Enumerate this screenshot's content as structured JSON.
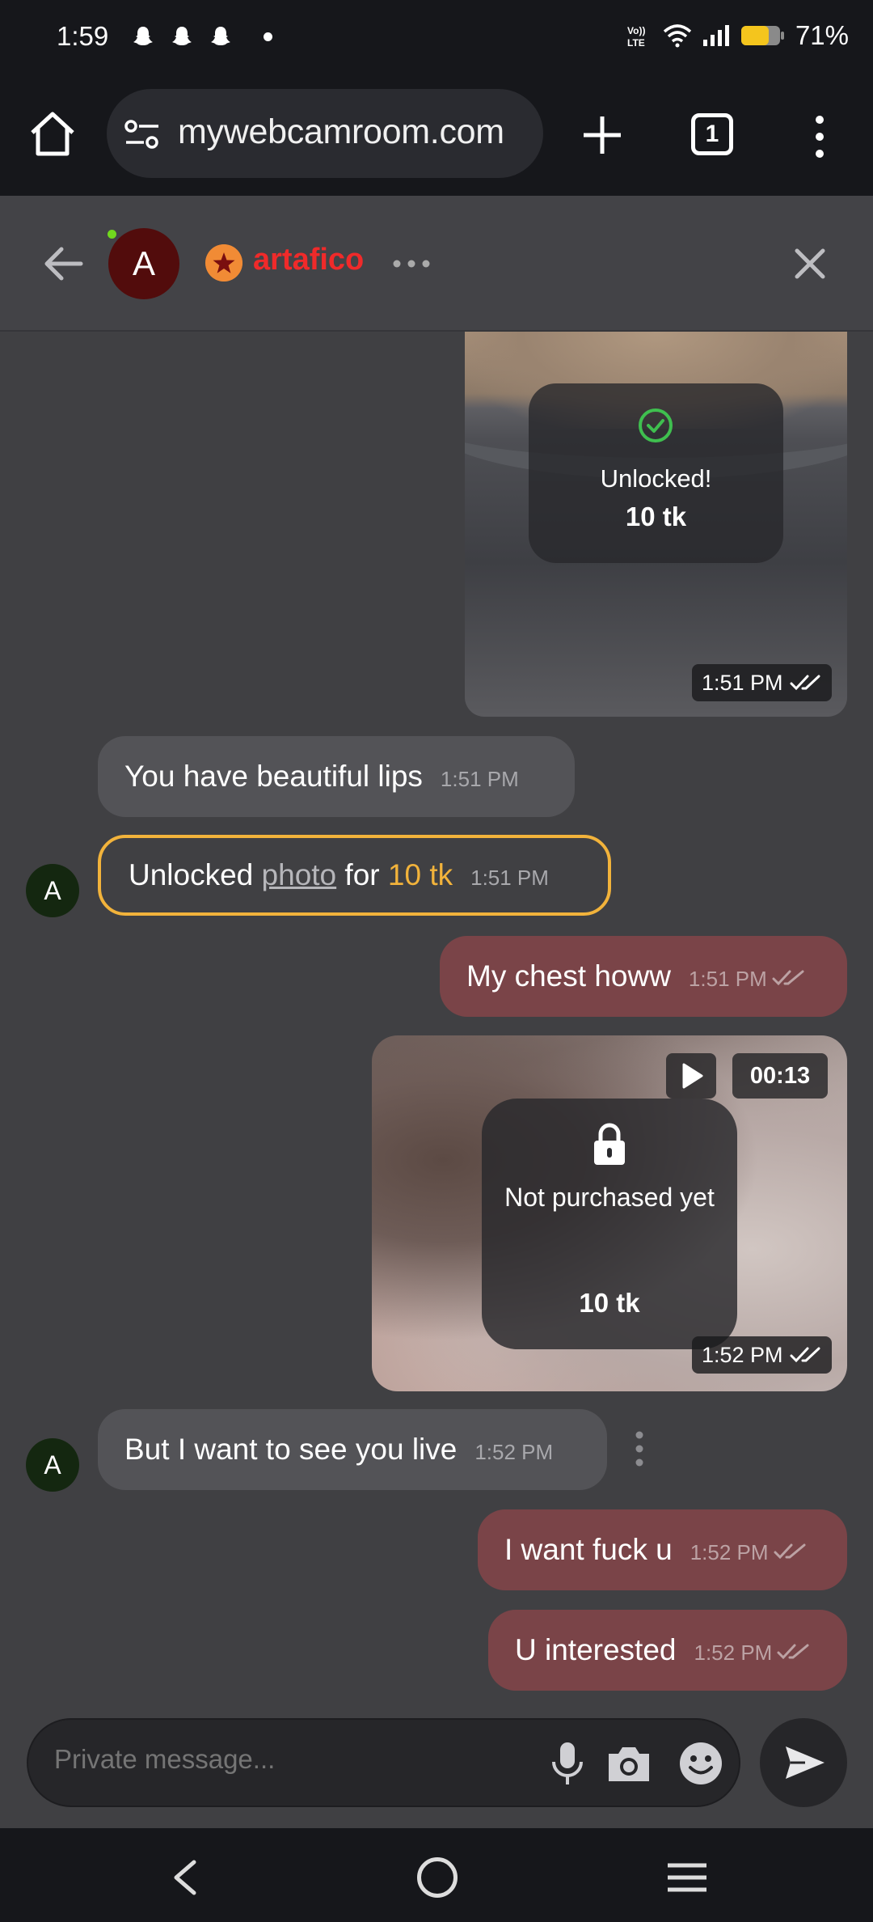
{
  "status_bar": {
    "time": "1:59",
    "battery_percent": "71%",
    "icons": [
      "snapchat-icon",
      "snapchat-icon",
      "snapchat-icon",
      "notification-dot",
      "volte-icon",
      "wifi-icon",
      "signal-icon",
      "battery-icon"
    ]
  },
  "browser": {
    "url": "mywebcamroom.com",
    "tab_count": "1"
  },
  "chat_header": {
    "avatar_letter": "A",
    "username": "artafico",
    "online": true
  },
  "messages": {
    "photo_unlocked": {
      "status": "Unlocked!",
      "price": "10 tk",
      "time": "1:51 PM"
    },
    "m1": {
      "text": "You have beautiful lips",
      "time": "1:51 PM"
    },
    "tip": {
      "prefix": "Unlocked",
      "link": "photo",
      "middle": "for",
      "amount": "10 tk",
      "time": "1:51 PM",
      "avatar_letter": "A"
    },
    "m2": {
      "text": "My chest howw",
      "time": "1:51 PM"
    },
    "video_locked": {
      "status": "Not purchased yet",
      "price": "10 tk",
      "duration": "00:13",
      "time": "1:52 PM"
    },
    "m3": {
      "text": "But I want to see you live",
      "time": "1:52 PM",
      "avatar_letter": "A"
    },
    "m4": {
      "text": "I want fuck u",
      "time": "1:52 PM"
    },
    "m5": {
      "text": "U interested",
      "time": "1:52 PM"
    }
  },
  "composer": {
    "placeholder": "Private message..."
  },
  "colors": {
    "outgoing_bubble": "#7a4448",
    "incoming_bubble": "#535357",
    "tip_border": "#f2b33b",
    "username": "#f02a2a",
    "online": "#71d91e"
  }
}
